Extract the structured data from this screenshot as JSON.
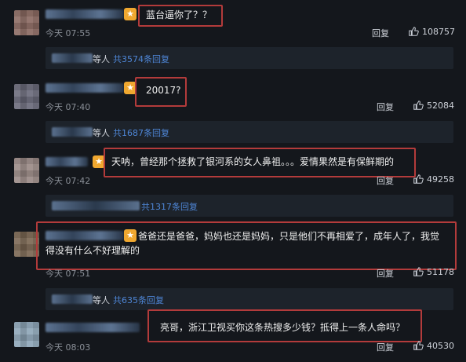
{
  "colors": {
    "background": "#14171c",
    "sub_panel": "#1d232b",
    "highlight_box": "#b33b3b",
    "link_blue": "#4e86d6"
  },
  "icons": {
    "like": "thumbs-up-icon",
    "badge": "vip-badge-icon"
  },
  "labels": {
    "reply": "回复",
    "etc": "等人"
  },
  "comments": [
    {
      "text": "蓝台逼你了？？",
      "time": "今天 07:55",
      "likes": "108757",
      "sub_count": "共3574条回复",
      "avatar_color": "#8b6a62"
    },
    {
      "text": "20017?",
      "time": "今天 07:40",
      "likes": "52084",
      "sub_count": "共1687条回复",
      "avatar_color": "#6a6a7a"
    },
    {
      "text": "天呐，曾经那个拯救了银河系的女人鼻祖。。。爱情果然是有保鲜期的",
      "time": "今天 07:42",
      "likes": "49258",
      "sub_count": "共1317条回复",
      "avatar_color": "#9a8a86"
    },
    {
      "text": "爸爸还是爸爸，妈妈也还是妈妈，只是他们不再相爱了，成年人了，我觉得没有什么不好理解的",
      "time": "今天 07:51",
      "likes": "51178",
      "sub_count": "共635条回复",
      "avatar_color": "#7a6652"
    },
    {
      "text": "亮哥，浙江卫视买你这条热搜多少钱？抵得上一条人命吗？",
      "time": "今天 08:03",
      "likes": "40530",
      "sub_count": "",
      "avatar_color": "#8ea6b8"
    }
  ]
}
